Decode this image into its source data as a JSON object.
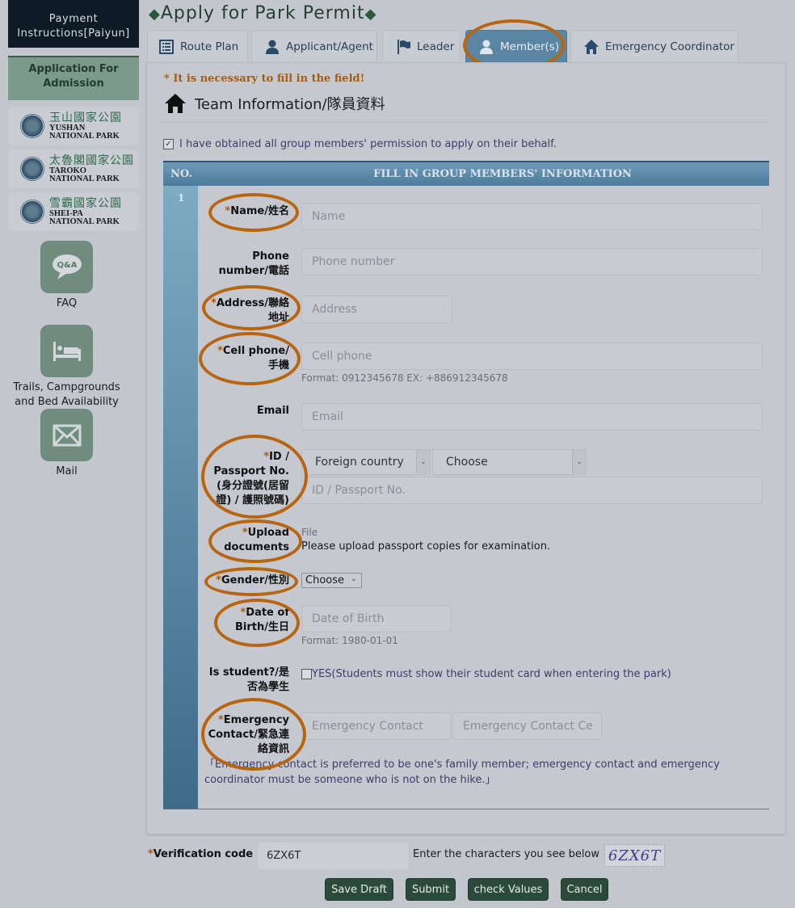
{
  "sidebar": {
    "payment": "Payment Instructions[Paiyun]",
    "application": "Application For Admission",
    "parks": [
      {
        "zh": "玉山國家公園",
        "en1": "YUSHAN",
        "en2": "NATIONAL PARK"
      },
      {
        "zh": "太魯閣國家公園",
        "en1": "TAROKO",
        "en2": "NATIONAL PARK"
      },
      {
        "zh": "雪霸國家公園",
        "en1": "SHEI-PA",
        "en2": "NATIONAL PARK"
      }
    ],
    "faq_icon_text": "Q&A",
    "faq": "FAQ",
    "trails_line1": "Trails, Campgrounds",
    "trails_line2": "and Bed Availability",
    "mail": "Mail"
  },
  "header": {
    "title": "Apply for Park Permit",
    "tabs": [
      {
        "label": "Route Plan",
        "icon": "list-icon"
      },
      {
        "label": "Applicant/Agent",
        "icon": "user-icon"
      },
      {
        "label": "Leader",
        "icon": "flag-icon"
      },
      {
        "label": "Member(s)",
        "icon": "user-icon",
        "active": true
      },
      {
        "label": "Emergency Coordinator",
        "icon": "home-icon"
      }
    ]
  },
  "form": {
    "required_note": "* It is necessary to fill in the field!",
    "section_title": "Team Information/隊員資料",
    "consent": "I have obtained all group members' permission to apply on their behalf.",
    "consent_checked": true,
    "table_no": "NO.",
    "table_title": "FILL IN GROUP MEMBERS' INFORMATION",
    "member_no": "1",
    "fields": {
      "name": {
        "label": "Name/姓名",
        "placeholder": "Name",
        "required": true
      },
      "phone": {
        "label1": "Phone",
        "label2": "number/電話",
        "placeholder": "Phone number"
      },
      "address": {
        "label1": "Address/聯絡",
        "label2": "地址",
        "placeholder": "Address",
        "required": true
      },
      "cell": {
        "label1": "Cell phone/",
        "label2": "手機",
        "placeholder": "Cell phone",
        "hint": "Format: 0912345678 EX: +886912345678",
        "required": true
      },
      "email": {
        "label": "Email",
        "placeholder": "Email"
      },
      "id": {
        "label1": "ID /",
        "label2": "Passport No.",
        "label3": "(身分證號(居留",
        "label4": "證) / 護照號碼)",
        "country": "Foreign country",
        "choose": "Choose",
        "placeholder": "ID / Passport No.",
        "required": true
      },
      "upload": {
        "label1": "Upload",
        "label2": "documents",
        "file": "File",
        "note": "Please upload passport copies for examination.",
        "required": true
      },
      "gender": {
        "label": "Gender/性別",
        "value": "Choose",
        "required": true
      },
      "dob": {
        "label1": "Date of",
        "label2": "Birth/生日",
        "placeholder": "Date of Birth",
        "hint": "Format: 1980-01-01",
        "required": true
      },
      "student": {
        "label1": "Is student?/是",
        "label2": "否為學生",
        "option": "YES(Students must show their student card when entering the park)",
        "checked": false
      },
      "emergency": {
        "label1": "Emergency",
        "label2": "Contact/緊急連",
        "label3": "絡資訊",
        "placeholder_name": "Emergency Contact",
        "placeholder_cell": "Emergency Contact Ce",
        "required": true
      },
      "emergency_note1": "「Emergency contact is preferred to be one's family member; emergency contact and emergency",
      "emergency_note2": "coordinator must be someone who is not on the hike.」"
    }
  },
  "footer": {
    "verification_label": "Verification code",
    "verification_value": "6ZX6T",
    "verification_hint": "Enter the characters you see below",
    "captcha_text": "6ZX6T",
    "buttons": [
      "Save Draft",
      "Submit",
      "check Values",
      "Cancel"
    ]
  },
  "colors": {
    "accent_ring": "#b8650f",
    "active_tab": "#5a86a4",
    "button": "#2c4a3c",
    "required": "#a55c10"
  }
}
